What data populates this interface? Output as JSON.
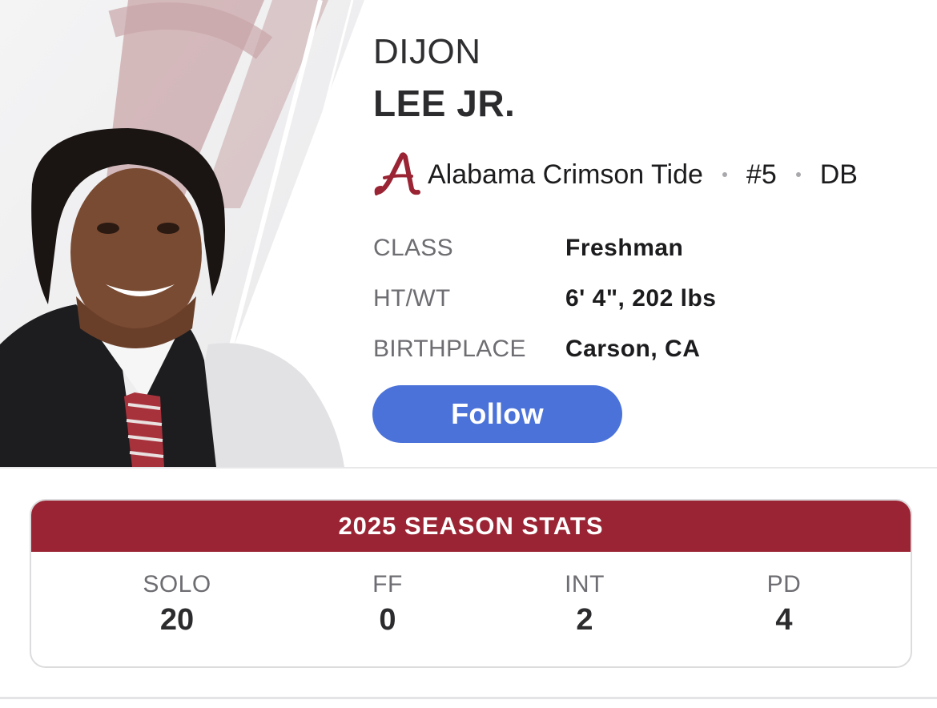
{
  "player": {
    "first_name": "DIJON",
    "last_name": "LEE JR.",
    "team": "Alabama Crimson Tide",
    "number": "#5",
    "position": "DB"
  },
  "info": [
    {
      "label": "CLASS",
      "value": "Freshman"
    },
    {
      "label": "HT/WT",
      "value": "6' 4\", 202 lbs"
    },
    {
      "label": "BIRTHPLACE",
      "value": "Carson, CA"
    }
  ],
  "follow_label": "Follow",
  "stats": {
    "title": "2025 SEASON STATS",
    "items": [
      {
        "label": "SOLO",
        "value": "20"
      },
      {
        "label": "FF",
        "value": "0"
      },
      {
        "label": "INT",
        "value": "2"
      },
      {
        "label": "PD",
        "value": "4"
      }
    ]
  },
  "colors": {
    "crimson": "#9a2433",
    "follow_blue": "#4a72d9"
  },
  "icons": {
    "team_logo": "alabama-script-a-icon",
    "player_photo": "player-headshot-image"
  }
}
